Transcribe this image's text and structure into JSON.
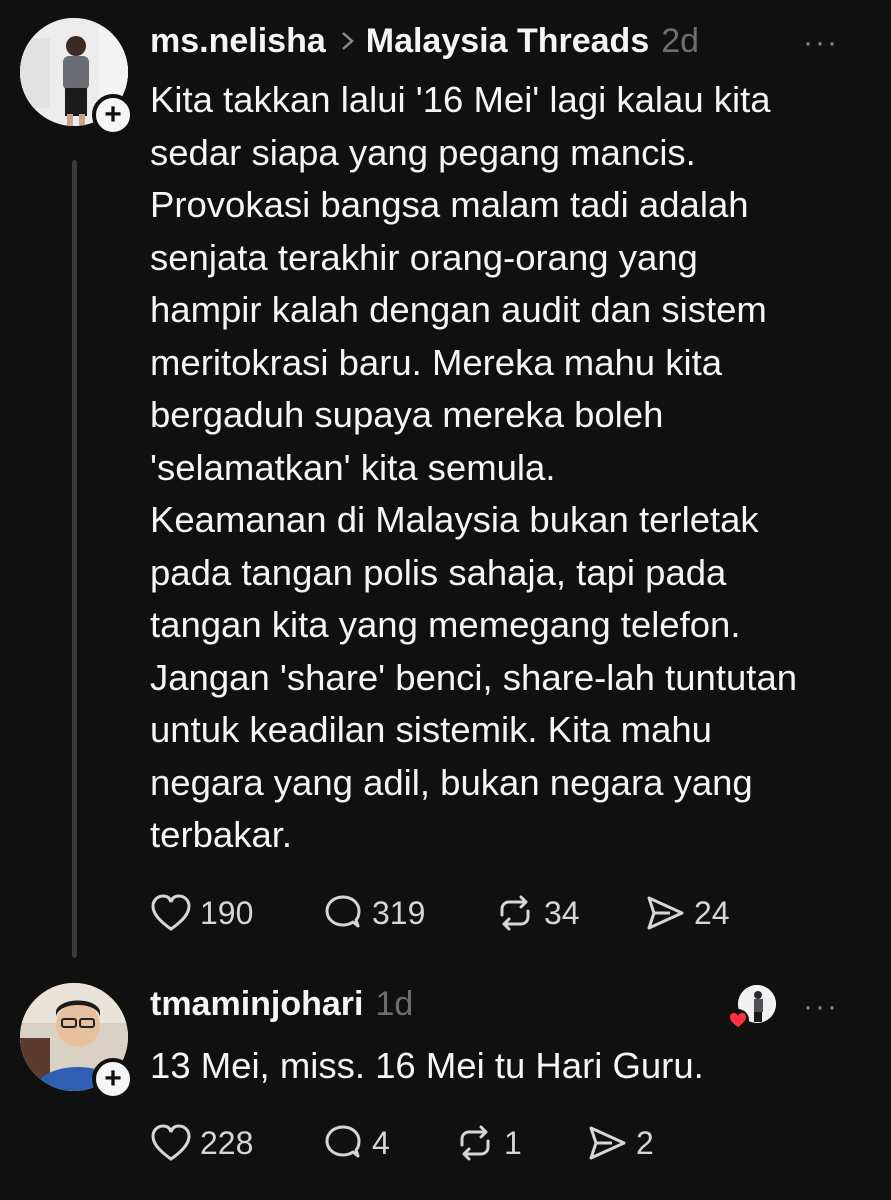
{
  "posts": [
    {
      "username": "ms.nelisha",
      "community": "Malaysia Threads",
      "time": "2d",
      "more": "···",
      "plus": "+",
      "text": "Kita takkan lalui '16 Mei' lagi kalau kita\nsedar siapa yang pegang mancis.\nProvokasi bangsa malam tadi adalah\nsenjata terakhir orang-orang yang\nhampir kalah dengan audit dan sistem\nmeritokrasi baru. Mereka mahu kita\nbergaduh supaya mereka boleh\n'selamatkan' kita semula.\nKeamanan di Malaysia bukan terletak\npada tangan polis sahaja, tapi pada\ntangan kita yang memegang telefon.\nJangan 'share' benci, share-lah tuntutan\nuntuk keadilan sistemik. Kita mahu\nnegara yang adil, bukan negara yang\nterbakar.",
      "likes": "190",
      "replies": "319",
      "reposts": "34",
      "shares": "24"
    },
    {
      "username": "tmaminjohari",
      "time": "1d",
      "more": "···",
      "plus": "+",
      "text": "13 Mei, miss. 16 Mei tu Hari Guru.",
      "likes": "228",
      "replies": "4",
      "reposts": "1",
      "shares": "2"
    }
  ],
  "colors": {
    "background": "#101010",
    "text": "#f3f5f7",
    "muted": "#6e6e6e",
    "heart_badge": "#ff3040"
  }
}
